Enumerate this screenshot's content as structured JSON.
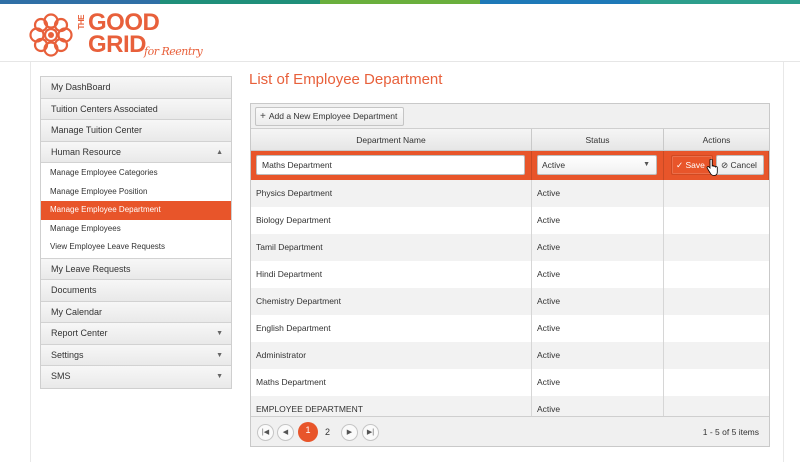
{
  "colors": {
    "accent": "#e8552a",
    "stripe": [
      "#2f6fa6",
      "#1f8f7a",
      "#6aaf3d",
      "#1e79b8",
      "#2d9e8c"
    ]
  },
  "brand": {
    "the": "THE",
    "good": "GOOD",
    "grid": "GRID",
    "tagline": "for Reentry"
  },
  "sidebar": {
    "items": [
      {
        "label": "My DashBoard"
      },
      {
        "label": "Tuition Centers Associated"
      },
      {
        "label": "Manage Tuition Center"
      },
      {
        "label": "Human Resource",
        "caret": "▲"
      }
    ],
    "sub_items": [
      {
        "label": "Manage Employee Categories"
      },
      {
        "label": "Manage Employee Position"
      },
      {
        "label": "Manage Employee Department",
        "active": true
      },
      {
        "label": "Manage Employees"
      },
      {
        "label": "View Employee Leave Requests"
      }
    ],
    "items_after": [
      {
        "label": "My Leave Requests"
      },
      {
        "label": "Documents"
      },
      {
        "label": "My Calendar"
      },
      {
        "label": "Report Center",
        "caret": "▼"
      },
      {
        "label": "Settings",
        "caret": "▼"
      },
      {
        "label": "SMS",
        "caret": "▼"
      }
    ]
  },
  "page": {
    "title": "List of Employee Department"
  },
  "grid": {
    "add_label": "Add a New Employee Department",
    "columns": [
      "Department Name",
      "Status",
      "Actions"
    ],
    "edit_row": {
      "name_value": "Maths Department",
      "status_value": "Active",
      "save_label": "Save",
      "cancel_label": "Cancel"
    },
    "rows": [
      {
        "name": "Physics Department",
        "status": "Active"
      },
      {
        "name": "Biology Department",
        "status": "Active"
      },
      {
        "name": "Tamil Department",
        "status": "Active"
      },
      {
        "name": "Hindi Department",
        "status": "Active"
      },
      {
        "name": "Chemistry Department",
        "status": "Active"
      },
      {
        "name": "English Department",
        "status": "Active"
      },
      {
        "name": "Administrator",
        "status": "Active"
      },
      {
        "name": "Maths Department",
        "status": "Active"
      },
      {
        "name": "EMPLOYEE DEPARTMENT",
        "status": "Active"
      }
    ],
    "pager": {
      "pages": [
        "1",
        "2"
      ],
      "current": "1",
      "info": "1 - 5 of 5 items"
    }
  }
}
